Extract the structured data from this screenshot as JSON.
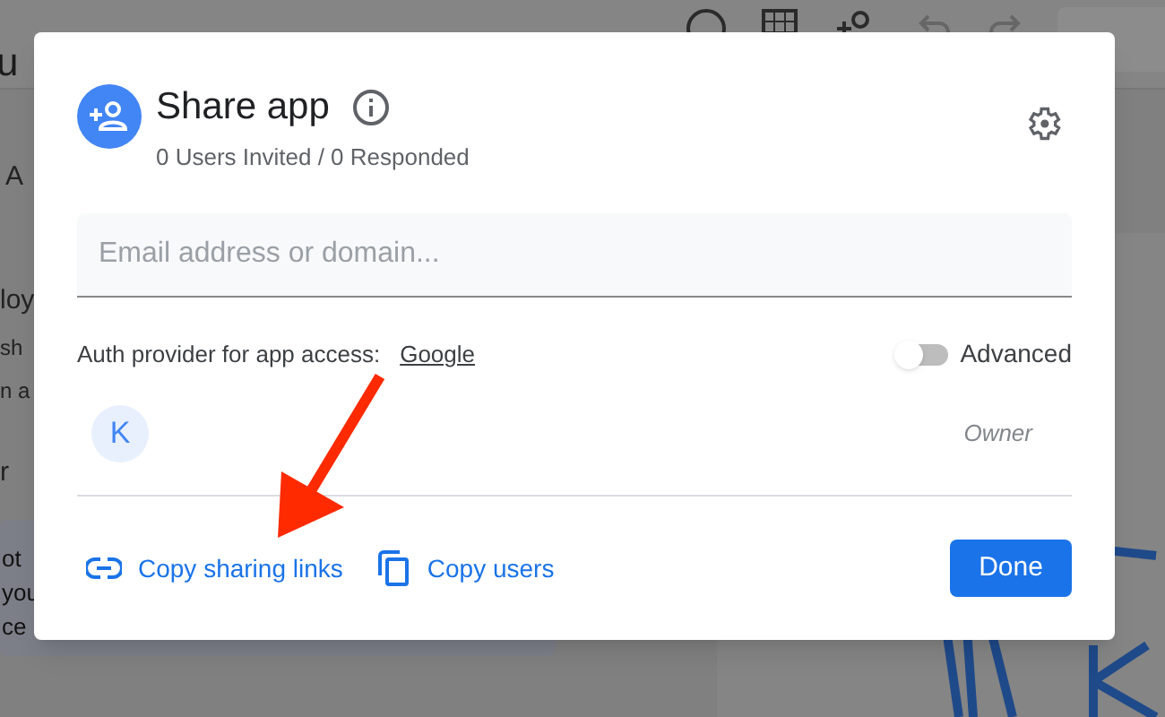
{
  "background": {
    "title": "u",
    "tab": "A",
    "fragments": [
      "loy",
      "sh",
      "n a",
      "r"
    ],
    "note_lines": [
      "ot",
      "you",
      "ce"
    ]
  },
  "dialog": {
    "title": "Share app",
    "subtitle": "0 Users Invited / 0 Responded",
    "email_field": {
      "placeholder": "Email address or domain..."
    },
    "auth_label": "Auth provider for app access:",
    "auth_provider": "Google",
    "advanced": {
      "label": "Advanced",
      "on": false
    },
    "users": [
      {
        "initial": "K",
        "role": "Owner"
      }
    ],
    "actions": [
      {
        "kind": "link",
        "label": "Copy sharing links"
      },
      {
        "kind": "copy",
        "label": "Copy users"
      }
    ],
    "done_label": "Done"
  }
}
